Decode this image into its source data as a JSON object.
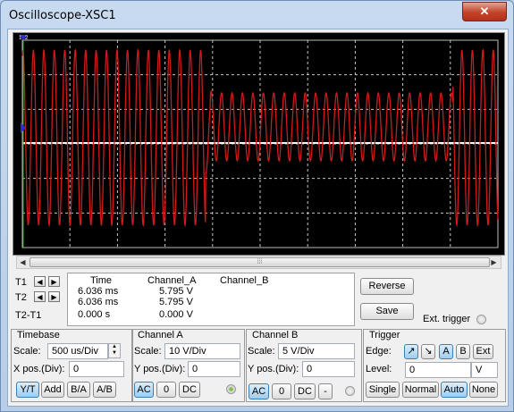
{
  "window": {
    "title": "Oscilloscope-XSC1",
    "close_label": "✕"
  },
  "scroll": {
    "grip": "⁞⁞⁞"
  },
  "readout": {
    "headers": {
      "time": "Time",
      "channel_a": "Channel_A",
      "channel_b": "Channel_B"
    },
    "rows": [
      {
        "label": "T1",
        "time": "6.036 ms",
        "a": "5.795 V",
        "b": ""
      },
      {
        "label": "T2",
        "time": "6.036 ms",
        "a": "5.795 V",
        "b": ""
      },
      {
        "label": "T2-T1",
        "time": "0.000 s",
        "a": "0.000 V",
        "b": ""
      }
    ]
  },
  "buttons": {
    "reverse": "Reverse",
    "save": "Save",
    "ext_trigger": "Ext. trigger"
  },
  "timebase": {
    "title": "Timebase",
    "scale_label": "Scale:",
    "scale_value": "500 us/Div",
    "xpos_label": "X pos.(Div):",
    "xpos_value": "0",
    "modes": [
      "Y/T",
      "Add",
      "B/A",
      "A/B"
    ],
    "selected_mode": "Y/T"
  },
  "channel_a": {
    "title": "Channel A",
    "scale_label": "Scale:",
    "scale_value": "10  V/Div",
    "ypos_label": "Y pos.(Div):",
    "ypos_value": "0",
    "coupling": [
      "AC",
      "0",
      "DC"
    ],
    "selected": "AC"
  },
  "channel_b": {
    "title": "Channel B",
    "scale_label": "Scale:",
    "scale_value": "5  V/Div",
    "ypos_label": "Y pos.(Div):",
    "ypos_value": "0",
    "coupling": [
      "AC",
      "0",
      "DC",
      "-"
    ],
    "selected": "AC"
  },
  "trigger": {
    "title": "Trigger",
    "edge_label": "Edge:",
    "edge_buttons": [
      "↗",
      "↘",
      "A",
      "B",
      "Ext"
    ],
    "level_label": "Level:",
    "level_value": "0",
    "level_unit": "V",
    "modes": [
      "Single",
      "Normal",
      "Auto",
      "None"
    ],
    "selected_mode": "Auto"
  },
  "colors": {
    "channel_a_trace": "#d01a1a",
    "channel_b_trace": "#ffffff",
    "grid": "#c8c8c8",
    "cursor_t1": "#2f2fd0",
    "cursor_t2": "#2fa02f"
  },
  "cursor_labels": {
    "t1": "1",
    "t2": "2"
  }
}
